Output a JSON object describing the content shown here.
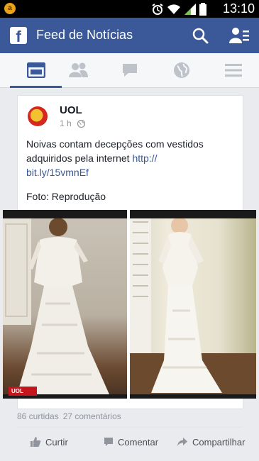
{
  "status": {
    "app_badge": "a",
    "clock": "13:10"
  },
  "header": {
    "logo": "f",
    "title": "Feed de Notícias"
  },
  "tabs": [
    {
      "name": "news-feed",
      "active": true
    },
    {
      "name": "friends",
      "active": false
    },
    {
      "name": "messages",
      "active": false
    },
    {
      "name": "notifications",
      "active": false
    },
    {
      "name": "menu",
      "active": false
    }
  ],
  "post": {
    "author": "UOL",
    "time": "1 h",
    "text": "Noivas contam decepções com vestidos adquiridos pela internet ",
    "link": "http://\nbit.ly/15vmnEf",
    "caption": "Foto: Reprodução",
    "photo_badge": "UOL",
    "likes": "86 curtidas",
    "comments": "27 comentários"
  },
  "actions": {
    "like": "Curtir",
    "comment": "Comentar",
    "share": "Compartilhar"
  },
  "colors": {
    "facebook_blue": "#3b5998",
    "link": "#365899",
    "uol_red": "#c4161c"
  }
}
